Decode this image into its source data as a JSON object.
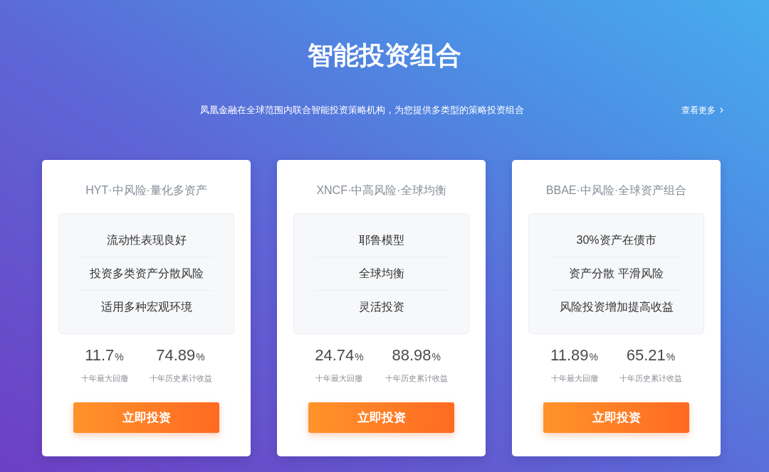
{
  "header": {
    "title": "智能投资组合",
    "subtitle": "凤凰金融在全球范围内联合智能投资策略机构，为您提供多类型的策略投资组合",
    "more_link": "查看更多"
  },
  "cards": [
    {
      "title": "HYT·中风险·量化多资产",
      "features": [
        "流动性表现良好",
        "投资多类资产分散风险",
        "适用多种宏观环境"
      ],
      "stats": [
        {
          "value": "11.7",
          "unit": "%",
          "label": "十年最大回撤"
        },
        {
          "value": "74.89",
          "unit": "%",
          "label": "十年历史累计收益"
        }
      ],
      "button": "立即投资"
    },
    {
      "title": "XNCF·中高风险·全球均衡",
      "features": [
        "耶鲁模型",
        "全球均衡",
        "灵活投资"
      ],
      "stats": [
        {
          "value": "24.74",
          "unit": "%",
          "label": "十年最大回撤"
        },
        {
          "value": "88.98",
          "unit": "%",
          "label": "十年历史累计收益"
        }
      ],
      "button": "立即投资"
    },
    {
      "title": "BBAE·中风险·全球资产组合",
      "features": [
        "30%资产在债市",
        "资产分散 平滑风险",
        "风险投资增加提高收益"
      ],
      "stats": [
        {
          "value": "11.89",
          "unit": "%",
          "label": "十年最大回撤"
        },
        {
          "value": "65.21",
          "unit": "%",
          "label": "十年历史累计收益"
        }
      ],
      "button": "立即投资"
    }
  ]
}
